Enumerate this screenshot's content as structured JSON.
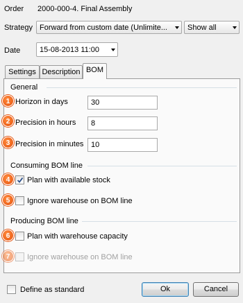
{
  "order": {
    "label": "Order",
    "value": "2000-000-4. Final Assembly"
  },
  "strategy": {
    "label": "Strategy",
    "selected": "Forward from custom date (Unlimite...",
    "view_selected": "Show all"
  },
  "date": {
    "label": "Date",
    "value": "15-08-2013 11:00"
  },
  "tabs": [
    {
      "label": "Settings",
      "active": false
    },
    {
      "label": "Description",
      "active": false
    },
    {
      "label": "BOM",
      "active": true
    }
  ],
  "general": {
    "title": "General",
    "fields": [
      {
        "badge": "1",
        "label": "Horizon in days",
        "value": "30"
      },
      {
        "badge": "2",
        "label": "Precision in hours",
        "value": "8"
      },
      {
        "badge": "3",
        "label": "Precision in minutes",
        "value": "10"
      }
    ]
  },
  "consuming": {
    "title": "Consuming BOM line",
    "options": [
      {
        "badge": "4",
        "label": "Plan with available stock",
        "checked": true,
        "enabled": true
      },
      {
        "badge": "5",
        "label": "Ignore warehouse on BOM line",
        "checked": false,
        "enabled": true
      }
    ]
  },
  "producing": {
    "title": "Producing BOM line",
    "options": [
      {
        "badge": "6",
        "label": "Plan with warehouse capacity",
        "checked": false,
        "enabled": true
      },
      {
        "badge": "7",
        "label": "Ignore warehouse on BOM line",
        "checked": false,
        "enabled": false
      }
    ]
  },
  "footer": {
    "define_standard_label": "Define as standard",
    "ok_label": "Ok",
    "cancel_label": "Cancel"
  },
  "colors": {
    "badge": "#e5520c",
    "default_button_border": "#3c7fb1",
    "section_line": "#d5dfe5"
  }
}
